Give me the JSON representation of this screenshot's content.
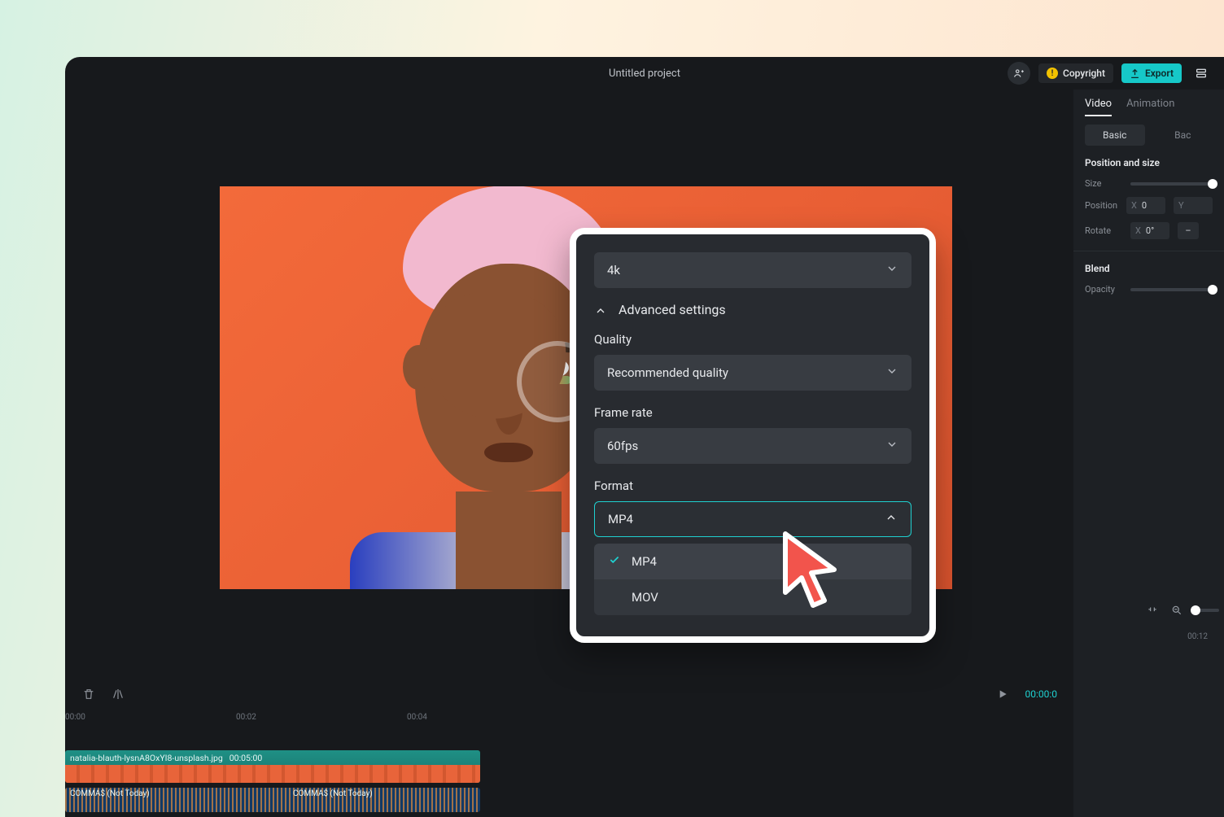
{
  "titlebar": {
    "title": "Untitled project",
    "copyright_label": "Copyright",
    "export_label": "Export"
  },
  "right_panel": {
    "tabs": [
      "Video",
      "Animation"
    ],
    "active_tab": 0,
    "subtabs": {
      "basic": "Basic",
      "background": "Bac"
    },
    "position_section": "Position and size",
    "size_label": "Size",
    "position_label": "Position",
    "position_x": "0",
    "position_y_axis": "Y",
    "rotate_label": "Rotate",
    "rotate_value": "0°",
    "blend_section": "Blend",
    "opacity_label": "Opacity"
  },
  "controls": {
    "current_time": "00:00:0"
  },
  "ruler": {
    "marks": [
      "00:00",
      "00:02",
      "00:04"
    ],
    "right_mark": "00:12"
  },
  "tracks": {
    "video_clip_name": "natalia-blauth-lysnA8OxYI8-unsplash.jpg",
    "video_clip_duration": "00:05:00",
    "audio_clip_name_a": "COMMA$ (Not Today)",
    "audio_clip_name_b": "COMMA$ (Not Today)"
  },
  "export_modal": {
    "resolution_value": "4k",
    "advanced_label": "Advanced settings",
    "quality_label": "Quality",
    "quality_value": "Recommended quality",
    "framerate_label": "Frame rate",
    "framerate_value": "60fps",
    "format_label": "Format",
    "format_value": "MP4",
    "format_options": [
      "MP4",
      "MOV"
    ],
    "format_selected_index": 0
  }
}
